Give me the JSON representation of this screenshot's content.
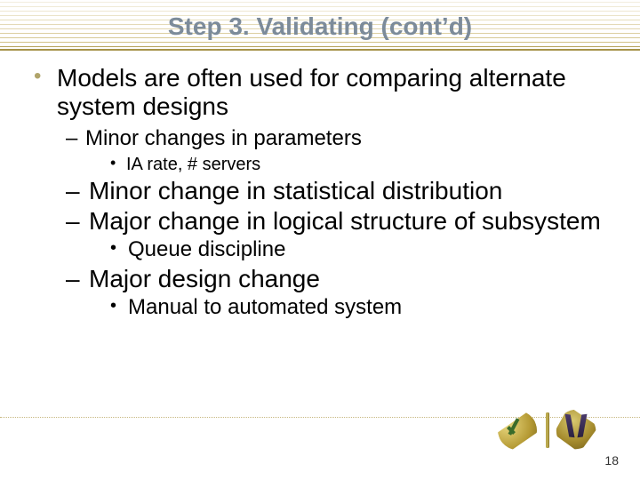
{
  "title": "Step 3. Validating (cont’d)",
  "bullets": {
    "main": "Models are often used for comparing alternate system designs",
    "sub_a": "Minor changes in parameters",
    "sub_a_1": "IA rate, # servers",
    "sub_b": "Minor change in statistical distribution",
    "sub_c": "Major change in logical structure of subsystem",
    "sub_c_1": "Queue discipline",
    "sub_d": "Major design change",
    "sub_d_1": "Manual to automated system"
  },
  "page_number": "18"
}
